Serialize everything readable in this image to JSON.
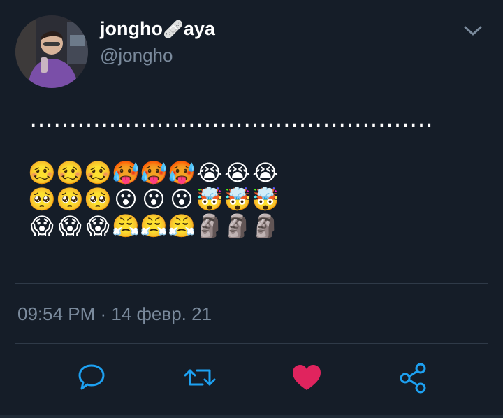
{
  "profile": {
    "name_part1": "jongho",
    "name_emoji": "🩹",
    "name_part2": "aya",
    "handle": "@jongho"
  },
  "tweet": {
    "text": "……………………………………………",
    "emoji_rows": [
      [
        "🥴",
        "🥴",
        "🥴",
        "🥵",
        "🥵",
        "🥵",
        "😭",
        "😭",
        "😭"
      ],
      [
        "🥺",
        "🥺",
        "🥺",
        "😮",
        "😮",
        "😮",
        "🤯",
        "🤯",
        "🤯"
      ],
      [
        "😱",
        "😱",
        "😱",
        "😤",
        "😤",
        "😤",
        "🗿",
        "🗿",
        "🗿"
      ]
    ]
  },
  "meta": {
    "timestamp": "09:54 PM · 14 февр. 21"
  },
  "actions": [
    {
      "name": "reply-button",
      "icon": "speech-bubble-icon",
      "color": "#1da1f2"
    },
    {
      "name": "retweet-button",
      "icon": "retweet-icon",
      "color": "#1da1f2"
    },
    {
      "name": "like-button",
      "icon": "heart-icon",
      "color": "#e0245e"
    },
    {
      "name": "share-button",
      "icon": "share-icon",
      "color": "#1da1f2"
    }
  ],
  "colors": {
    "background": "#151d28",
    "secondary_text": "#7a8a9c",
    "accent": "#1da1f2",
    "like": "#e0245e",
    "divider": "#2f3a48"
  }
}
